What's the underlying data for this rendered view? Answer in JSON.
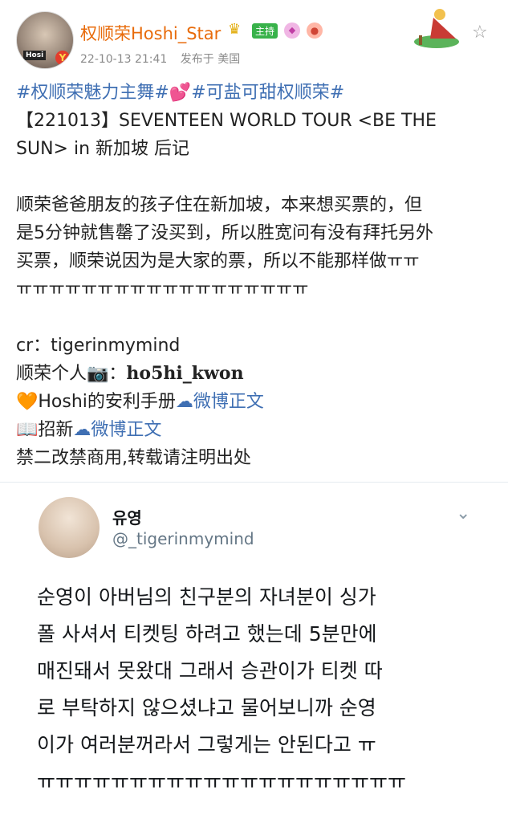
{
  "header": {
    "username": "权顺荣Hoshi_Star",
    "host_badge": "主持",
    "timestamp": "22-10-13 21:41",
    "location": "发布于 美国",
    "avatar_tag": "Hosi",
    "avatar_badge": "Y"
  },
  "post": {
    "hashtags": [
      "#权顺荣魅力主舞#",
      "💕",
      "#可盐可甜权顺荣#"
    ],
    "lines": [
      "【221013】SEVENTEEN WORLD TOUR <BE THE",
      "SUN> in 新加坡 后记",
      "顺荣爸爸朋友的孩子住在新加坡，本来想买票的，但",
      "是5分钟就售罄了没买到，所以胜宽问有没有拜托另外",
      "买票，顺荣说因为是大家的票，所以不能那样做ㅠㅠ",
      "ㅠㅠㅠㅠㅠㅠㅠㅠㅠㅠㅠㅠㅠㅠㅠㅠㅠㅠ",
      "cr：tigerinmymind"
    ],
    "personal_label": " 顺荣个人📷：",
    "personal_handle": "ho5hi_kwon",
    "manual_prefix": "🧡Hoshi的安利手册",
    "manual_link": "微博正文",
    "recruit_prefix": "📖招新",
    "recruit_link": "微博正文",
    "footer": "禁二改禁商用,转载请注明出处"
  },
  "tweet": {
    "name": "유영",
    "handle": "@_tigerinmymind",
    "lines": [
      "순영이 아버님의 친구분의 자녀분이 싱가",
      "폴 사셔서 티켓팅 하려고 했는데 5분만에",
      "매진돼서 못왔대 그래서 승관이가 티켓 따",
      "로 부탁하지 않으셨냐고 물어보니까 순영",
      "이가 여러분꺼라서 그렇게는 안된다고 ㅠ",
      "ㅠㅠㅠㅠㅠㅠㅠㅠㅠㅠㅠㅠㅠㅠㅠㅠㅠㅠㅠㅠ"
    ]
  },
  "icons": {
    "crown": "crown-icon",
    "gem": "gem-icon",
    "fan": "fan-badge-icon",
    "star": "star-outline-icon",
    "chevron": "chevron-down-icon",
    "weibo_link": "link-cloud-icon"
  },
  "colors": {
    "username": "#e86b0b",
    "link": "#3f6fb3",
    "meta": "#8a8a8a",
    "tweet_handle": "#657786"
  }
}
